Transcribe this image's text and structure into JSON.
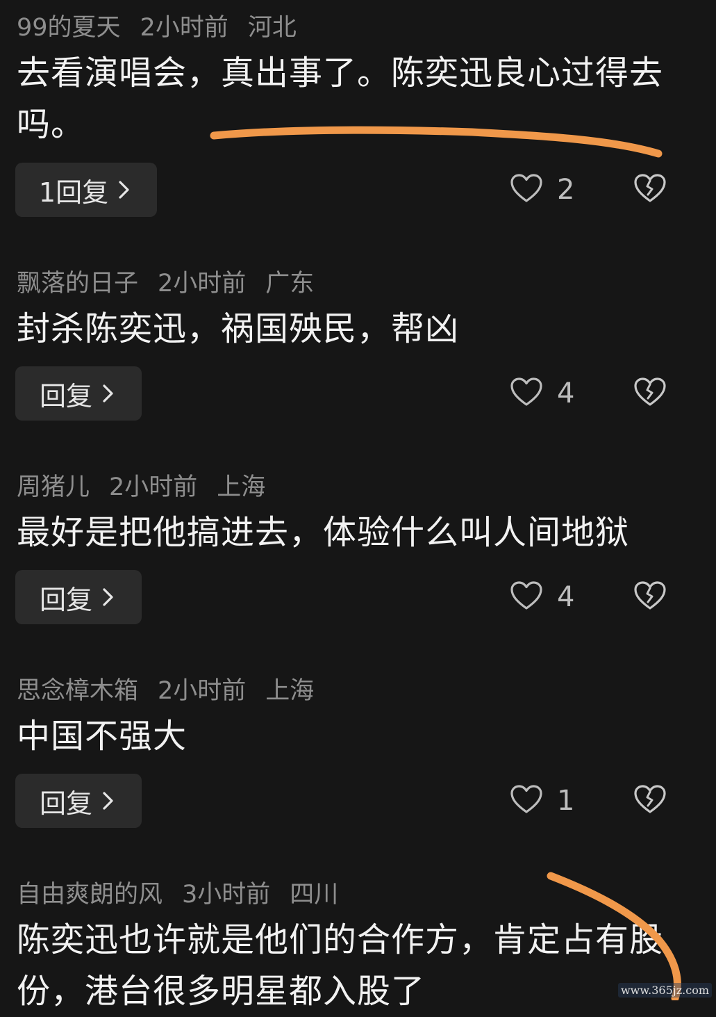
{
  "comments": [
    {
      "author": "99的夏天",
      "time": "2小时前",
      "location": "河北",
      "text": "去看演唱会，真出事了。陈奕迅良心过得去吗。",
      "reply_label": "1回复",
      "likes": "2"
    },
    {
      "author": "飘落的日子",
      "time": "2小时前",
      "location": "广东",
      "text": "封杀陈奕迅，祸国殃民，帮凶",
      "reply_label": "回复",
      "likes": "4"
    },
    {
      "author": "周猪儿",
      "time": "2小时前",
      "location": "上海",
      "text": "最好是把他搞进去，体验什么叫人间地狱",
      "reply_label": "回复",
      "likes": "4"
    },
    {
      "author": "思念樟木箱",
      "time": "2小时前",
      "location": "上海",
      "text": "中国不强大",
      "reply_label": "回复",
      "likes": "1"
    },
    {
      "author": "自由爽朗的风",
      "time": "3小时前",
      "location": "四川",
      "text": "陈奕迅也许就是他们的合作方，肯定占有股份，港台很多明星都入股了"
    }
  ],
  "watermark": "www.365jz.com",
  "icons": {
    "like": "heart-outline-icon",
    "dislike": "broken-heart-icon",
    "reply_arrow": "chevron-right-icon"
  },
  "colors": {
    "background": "#161616",
    "meta_text": "#8e8e8e",
    "body_text": "#f2f2f2",
    "reply_button_bg": "#2b2b2b",
    "annotation_stroke": "#f0984a"
  }
}
